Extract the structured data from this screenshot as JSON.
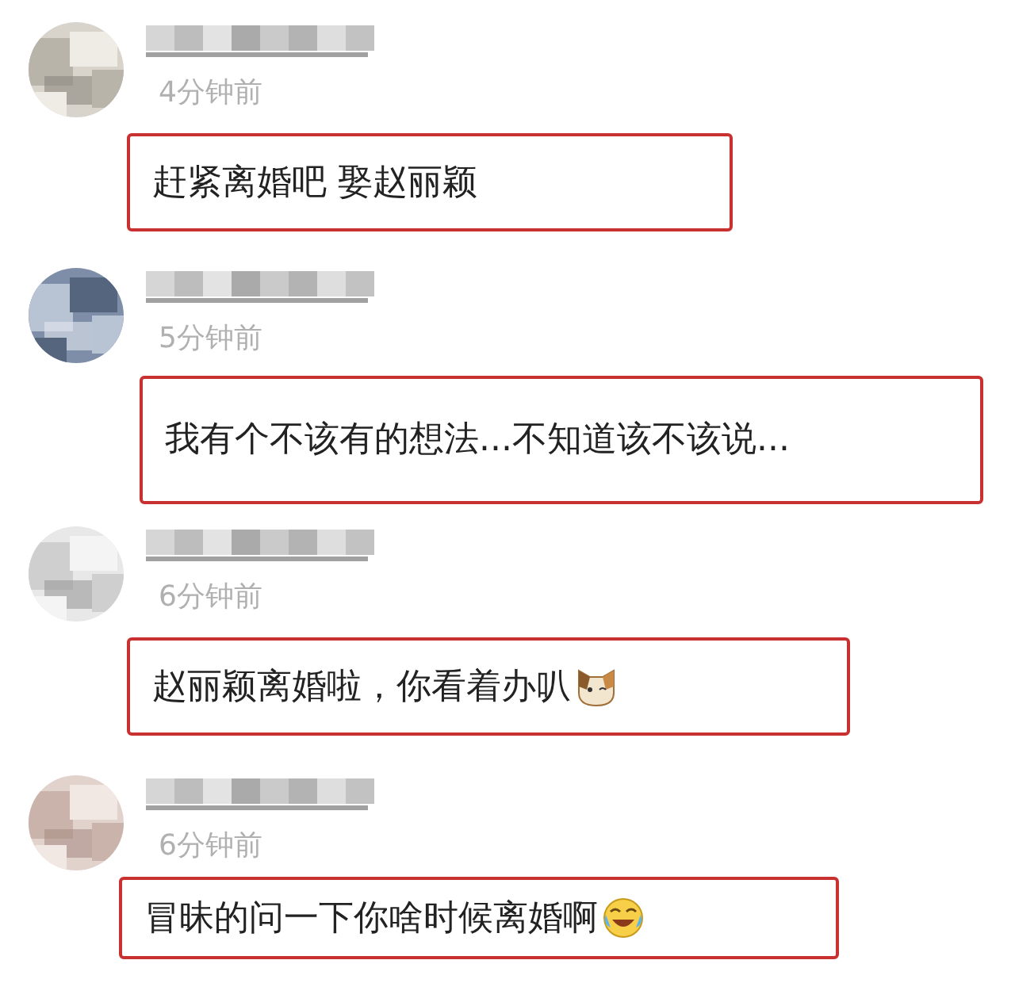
{
  "comments": [
    {
      "time": "4分钟前",
      "text": "赶紧离婚吧 娶赵丽颖"
    },
    {
      "time": "5分钟前",
      "text": "我有个不该有的想法...不知道该不该说..."
    },
    {
      "time": "6分钟前",
      "text": "赵丽颖离婚啦，你看着办叭",
      "emoji": {
        "kind": "cat"
      }
    },
    {
      "time": "6分钟前",
      "text": "冒昧的问一下你啥时候离婚啊",
      "emoji": {
        "kind": "laugh"
      }
    }
  ]
}
